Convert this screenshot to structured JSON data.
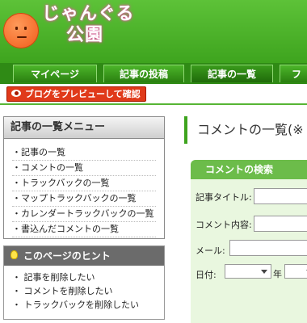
{
  "logo": {
    "line1": "じゃんぐる",
    "line2": "公園"
  },
  "nav": {
    "tabs": [
      "マイページ",
      "記事の投稿",
      "記事の一覧",
      "フ"
    ]
  },
  "preview_button": "ブログをプレビューして確認",
  "sidebar": {
    "menu_title": "記事の一覧メニュー",
    "menu_items": [
      "・記事の一覧",
      "・コメントの一覧",
      "・トラックバックの一覧",
      "・マップトラックバックの一覧",
      "・カレンダートラックバックの一覧",
      "・書込んだコメントの一覧"
    ],
    "hint_title": "このページのヒント",
    "hint_items": [
      "・ 記事を削除したい",
      "・ コメントを削除したい",
      "・ トラックバックを削除したい"
    ]
  },
  "main": {
    "page_title": "コメントの一覧(※",
    "search": {
      "title": "コメントの検索",
      "article_title_label": "記事タイトル:",
      "comment_label": "コメント内容:",
      "mail_label": "メール:",
      "date_label": "日付:",
      "year_label": "年"
    }
  }
}
